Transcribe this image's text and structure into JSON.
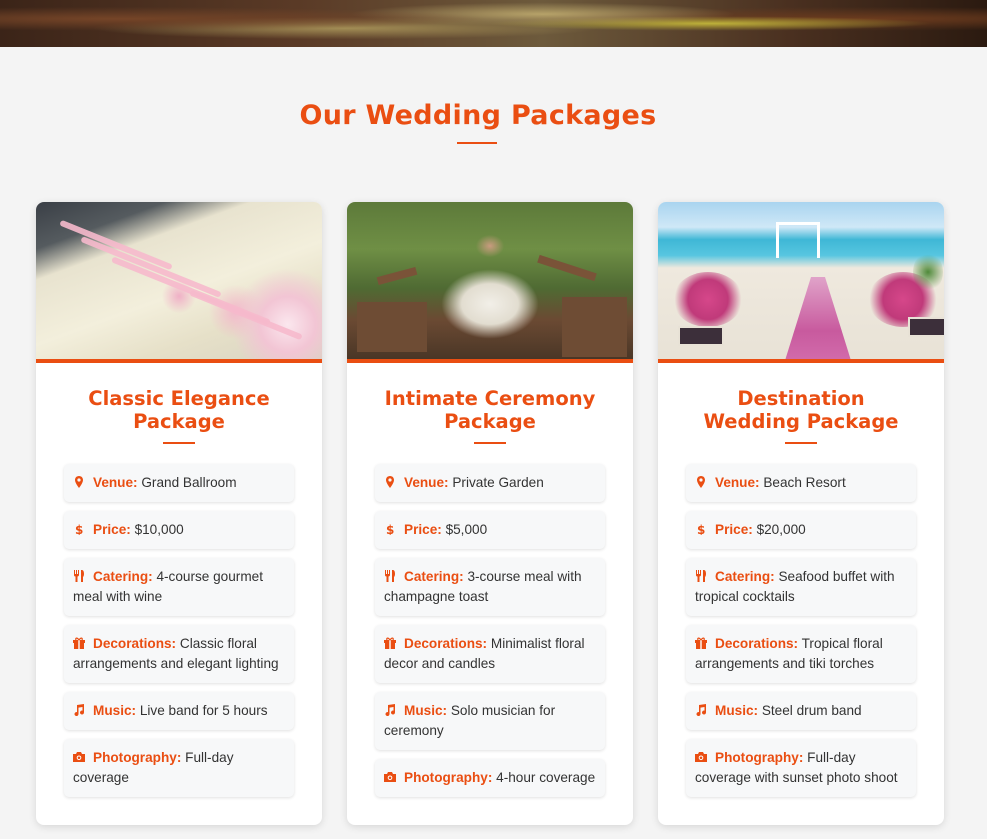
{
  "section": {
    "title": "Our Wedding Packages"
  },
  "colors": {
    "accent": "#ea4e12",
    "background": "#f4f4f4",
    "card": "#ffffff",
    "item_bg": "#f7f8f9"
  },
  "packages": [
    {
      "title": "Classic Elegance Package",
      "image": "banquet-table-photo",
      "items": [
        {
          "icon": "map-marker-icon",
          "label": "Venue:",
          "value": "Grand Ballroom"
        },
        {
          "icon": "dollar-icon",
          "label": "Price:",
          "value": "$10,000"
        },
        {
          "icon": "utensils-icon",
          "label": "Catering:",
          "value": "4-course gourmet meal with wine"
        },
        {
          "icon": "gift-icon",
          "label": "Decorations:",
          "value": "Classic floral arrangements and elegant lighting"
        },
        {
          "icon": "music-icon",
          "label": "Music:",
          "value": "Live band for 5 hours"
        },
        {
          "icon": "camera-icon",
          "label": "Photography:",
          "value": "Full-day coverage"
        }
      ]
    },
    {
      "title": "Intimate Ceremony Package",
      "image": "garden-bride-photo",
      "items": [
        {
          "icon": "map-marker-icon",
          "label": "Venue:",
          "value": "Private Garden"
        },
        {
          "icon": "dollar-icon",
          "label": "Price:",
          "value": "$5,000"
        },
        {
          "icon": "utensils-icon",
          "label": "Catering:",
          "value": "3-course meal with champagne toast"
        },
        {
          "icon": "gift-icon",
          "label": "Decorations:",
          "value": "Minimalist floral decor and candles"
        },
        {
          "icon": "music-icon",
          "label": "Music:",
          "value": "Solo musician for ceremony"
        },
        {
          "icon": "camera-icon",
          "label": "Photography:",
          "value": "4-hour coverage"
        }
      ]
    },
    {
      "title": "Destination Wedding Package",
      "image": "beach-ceremony-photo",
      "items": [
        {
          "icon": "map-marker-icon",
          "label": "Venue:",
          "value": "Beach Resort"
        },
        {
          "icon": "dollar-icon",
          "label": "Price:",
          "value": "$20,000"
        },
        {
          "icon": "utensils-icon",
          "label": "Catering:",
          "value": "Seafood buffet with tropical cocktails"
        },
        {
          "icon": "gift-icon",
          "label": "Decorations:",
          "value": "Tropical floral arrangements and tiki torches"
        },
        {
          "icon": "music-icon",
          "label": "Music:",
          "value": "Steel drum band"
        },
        {
          "icon": "camera-icon",
          "label": "Photography:",
          "value": "Full-day coverage with sunset photo shoot"
        }
      ]
    }
  ]
}
